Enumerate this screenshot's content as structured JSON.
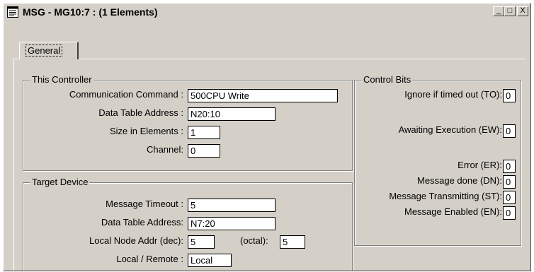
{
  "window": {
    "title": "MSG - MG10:7 : (1 Elements)",
    "buttons": {
      "minimize": "_",
      "maximize": "□",
      "close": "X"
    }
  },
  "tabs": [
    {
      "label": "General",
      "active": true
    }
  ],
  "this_controller": {
    "legend": "This Controller",
    "communication_command": {
      "label": "Communication Command :",
      "value": "500CPU Write"
    },
    "data_table_address": {
      "label": "Data Table Address :",
      "value": "N20:10"
    },
    "size_in_elements": {
      "label": "Size in Elements :",
      "value": "1"
    },
    "channel": {
      "label": "Channel:",
      "value": "0"
    }
  },
  "target_device": {
    "legend": "Target Device",
    "message_timeout": {
      "label": "Message Timeout :",
      "value": "5"
    },
    "data_table_address": {
      "label": "Data Table Address:",
      "value": "N7:20"
    },
    "local_node_addr": {
      "label": "Local Node Addr (dec):",
      "value": "5"
    },
    "octal": {
      "label": "(octal):",
      "value": "5"
    },
    "local_remote": {
      "label": "Local / Remote :",
      "value": "Local"
    }
  },
  "control_bits": {
    "legend": "Control Bits",
    "ignore_timeout": {
      "label": "Ignore if timed out (TO):",
      "value": "0"
    },
    "awaiting_execution": {
      "label": "Awaiting Execution (EW):",
      "value": "0"
    },
    "error": {
      "label": "Error (ER):",
      "value": "0"
    },
    "message_done": {
      "label": "Message done (DN):",
      "value": "0"
    },
    "message_transmitting": {
      "label": "Message Transmitting (ST):",
      "value": "0"
    },
    "message_enabled": {
      "label": "Message Enabled (EN):",
      "value": "0"
    }
  },
  "icons": {
    "title_icon": "message-window-icon"
  }
}
